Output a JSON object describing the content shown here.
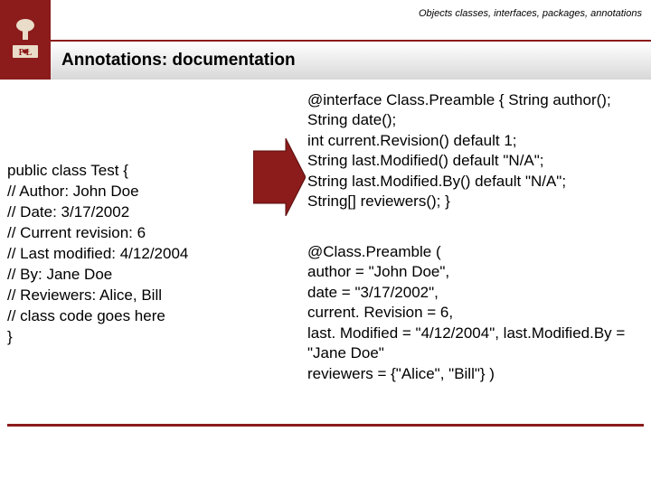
{
  "header": {
    "breadcrumb": "Objects classes, interfaces, packages,\nannotations",
    "title": "Annotations: documentation"
  },
  "left_code": "public class Test {\n// Author: John Doe\n// Date: 3/17/2002\n// Current revision: 6\n// Last modified: 4/12/2004\n// By: Jane Doe\n// Reviewers: Alice, Bill\n// class code goes here\n}",
  "right_top": "@interface Class.Preamble { String author();\nString date();\nint current.Revision() default 1;\nString last.Modified() default \"N/A\";\nString last.Modified.By() default \"N/A\";\nString[] reviewers(); }",
  "right_bottom": "@Class.Preamble (\nauthor = \"John Doe\",\ndate = \"3/17/2002\",\ncurrent. Revision = 6,\nlast. Modified = \"4/12/2004\", last.Modified.By = \"Jane Doe\"\nreviewers = {\"Alice\", \"Bill\"}  )",
  "colors": {
    "brand": "#8c1b1b"
  }
}
